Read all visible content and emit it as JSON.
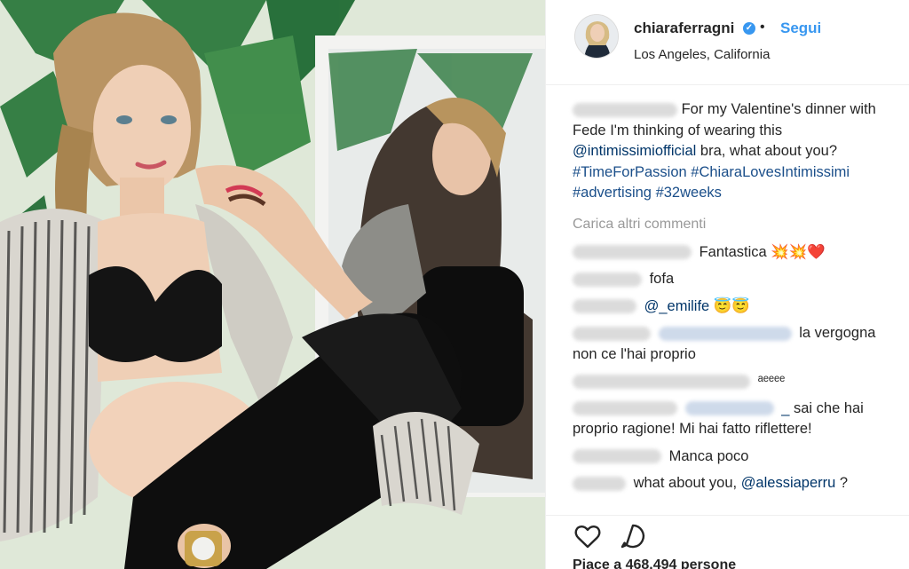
{
  "post": {
    "username": "chiaraferragni",
    "follow_label": "Segui",
    "separator": "•",
    "location": "Los Angeles, California"
  },
  "caption": {
    "text": "For my Valentine's dinner with Fede I'm thinking of wearing this",
    "mention": "@intimissimiofficial",
    "text2": "bra, what about you?",
    "hashtags": [
      "#TimeForPassion",
      "#ChiaraLovesIntimissimi",
      "#advertising",
      "#32weeks"
    ]
  },
  "load_more_label": "Carica altri commenti",
  "comments": [
    {
      "text": "Fantastica",
      "emoji": "💥💥❤️"
    },
    {
      "text": "fofa"
    },
    {
      "mention": "@_emilife",
      "emoji": "😇😇"
    },
    {
      "text": "la vergogna non ce l'hai proprio"
    },
    {
      "text": "ᵃᵉᵉᵉᵉ"
    },
    {
      "mention": "_",
      "text": "sai che hai proprio ragione! Mi hai fatto riflettere!"
    },
    {
      "text": "Manca poco"
    },
    {
      "text": "what about you,",
      "mention": "@alessiaperru",
      "text2": "?"
    }
  ],
  "likes_label": "Piace a 468.494 persone",
  "icons": {
    "like": "heart-icon",
    "comment": "comment-bubble-icon",
    "verified": "verified-badge-icon"
  },
  "colors": {
    "link": "#003569",
    "accent": "#3897f0",
    "muted": "#999999"
  }
}
